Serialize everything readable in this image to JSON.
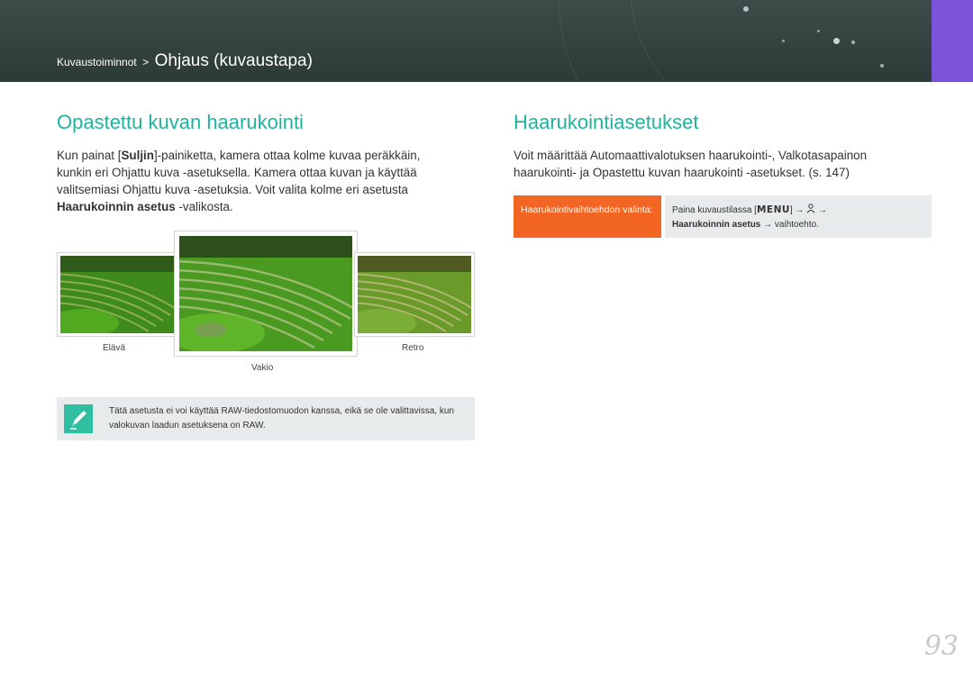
{
  "header": {
    "breadcrumb_parent": "Kuvaustoiminnot",
    "breadcrumb_separator": ">",
    "breadcrumb_current": "Ohjaus (kuvaustapa)",
    "background_color": "#33413f",
    "tab_color": "#7b54d9"
  },
  "left": {
    "title": "Opastettu kuvan haarukointi",
    "para_pre": "Kun painat [",
    "para_bold1": "Suljin",
    "para_mid": "]-painiketta, kamera ottaa kolme kuvaa peräkkäin, kunkin eri Ohjattu kuva -asetuksella. Kamera ottaa kuvan ja käyttää valitsemiasi Ohjattu kuva -asetuksia. Voit valita kolme eri asetusta ",
    "para_bold2": "Haarukoinnin asetus",
    "para_post": " -valikosta.",
    "images": [
      {
        "caption": "Elävä"
      },
      {
        "caption": "Vakio"
      },
      {
        "caption": "Retro"
      }
    ],
    "note_icon": "pencil-note-icon",
    "note_text": "Tätä asetusta ei voi käyttää RAW-tiedostomuodon kanssa, eikä se ole valittavissa, kun valokuvan laadun asetuksena on RAW."
  },
  "right": {
    "title": "Haarukointiasetukset",
    "para": "Voit määrittää Automaattivalotuksen haarukointi-, Valkotasapainon haarukointi- ja Opastettu kuvan haarukointi -asetukset. (s. 147)",
    "option_label": "Haarukointivaihtoehdon valinta:",
    "option_line1_pre": "Paina kuvaustilassa [",
    "option_menu": "MENU",
    "option_line1_post": "] → ",
    "option_icon": "camera-person-icon",
    "option_arrow": " →",
    "option_bold": "Haarukoinnin asetus",
    "option_line2_post": " → vaihtoehto."
  },
  "page_number": "93",
  "accent_color": "#1fb39e",
  "option_label_color": "#f26522"
}
